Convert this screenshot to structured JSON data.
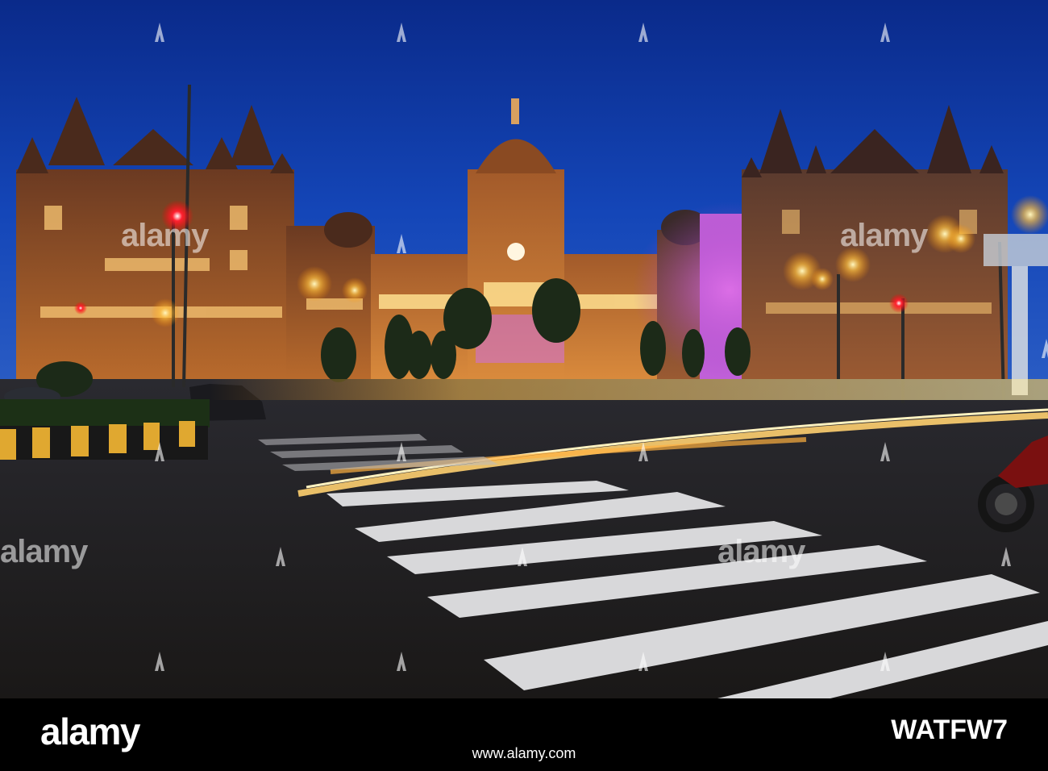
{
  "watermark": {
    "text": "alamy",
    "icon": "alamy-a-icon"
  },
  "footer": {
    "brand": "alamy",
    "url": "www.alamy.com",
    "image_id": "WATFW7"
  }
}
